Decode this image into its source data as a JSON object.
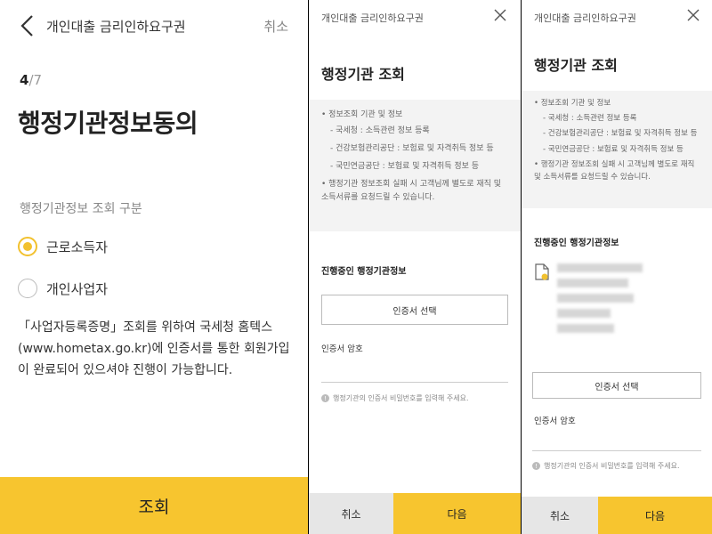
{
  "screen1": {
    "header_title": "개인대출 금리인하요구권",
    "cancel_label": "취소",
    "step_current": "4",
    "step_total": "/7",
    "heading": "행정기관정보동의",
    "section_label": "행정기관정보 조회 구분",
    "options": [
      {
        "label": "근로소득자",
        "selected": true
      },
      {
        "label": "개인사업자",
        "selected": false
      }
    ],
    "note": "「사업자등록증명」조회를 위하여 국세청 홈텍스 (www.hometax.go.kr)에 인증서를 통한 회원가입이 완료되어 있으셔야 진행이 가능합니다.",
    "submit_label": "조회",
    "accent_color": "#f7c52f"
  },
  "screen2": {
    "header_title": "개인대출 금리인하요구권",
    "page_title": "행정기관 조회",
    "info": {
      "heading": "• 정보조회 기관 및 정보",
      "items": [
        "- 국세청 : 소득관련 정보 등록",
        "- 건강보험관리공단 : 보험료 및 자격취득 정보 등",
        "- 국민연금공단 : 보험료 및 자격취득 정보 등"
      ],
      "note": "• 행정기관 정보조회 실패 시 고객님께 별도로 재직 및 소득서류를 요청드릴 수 있습니다."
    },
    "section_label": "진행중인 행정기관정보",
    "cert_button": "인증서 선택",
    "pw_label": "인증서 암호",
    "pw_hint": "행정기관의 인증서 비밀번호를 입력해 주세요.",
    "cancel_label": "취소",
    "next_label": "다음"
  },
  "screen3": {
    "header_title": "개인대출 금리인하요구권",
    "page_title": "행정기관 조회",
    "info": {
      "heading": "• 정보조회 기관 및 정보",
      "items": [
        "- 국세청 : 소득관련 정보 등록",
        "- 건강보험관리공단 : 보험료 및 자격취득 정보 등",
        "- 국민연금공단 : 보험료 및 자격취득 정보 등"
      ],
      "note": "• 행정기관 정보조회 실패 시 고객님께 별도로 재직 및 소득서류를 요청드릴 수 있습니다."
    },
    "section_label": "진행중인 행정기관정보",
    "cert_button": "인증서 선택",
    "pw_label": "인증서 암호",
    "pw_hint": "행정기관의 인증서 비밀번호를 입력해 주세요.",
    "cancel_label": "취소",
    "next_label": "다음"
  }
}
